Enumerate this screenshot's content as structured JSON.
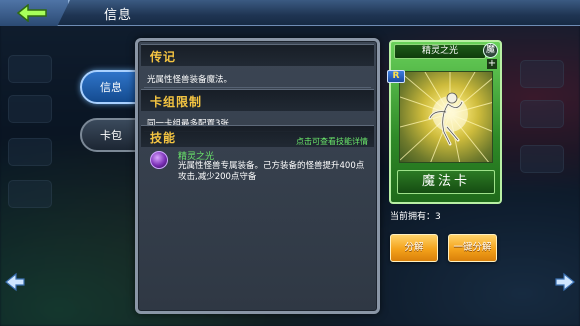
{
  "header": {
    "title": "信息"
  },
  "tabs": [
    {
      "label": "信息",
      "active": true
    },
    {
      "label": "卡包",
      "active": false
    }
  ],
  "info": {
    "lore": {
      "title": "传记",
      "text": "光属性怪兽装备魔法。"
    },
    "deck_limit": {
      "title": "卡组限制",
      "text": "同一卡组最多配置3张"
    },
    "skill": {
      "title": "技能",
      "detail_link": "点击可查看技能详情",
      "name": "精灵之光",
      "description": "光属性怪兽专属装备。己方装备的怪兽提升400点攻击,减少200点守备"
    }
  },
  "card": {
    "name": "精灵之光",
    "attribute": "魔",
    "rarity": "R",
    "plus": "+",
    "type": "魔法卡"
  },
  "owned": "当前拥有：3",
  "buttons": {
    "decompose": "分解",
    "decompose_all": "一键分解"
  },
  "colors": {
    "accent_gold": "#f5c542",
    "skill_green": "#6be86b",
    "button_orange": "#f4a21b"
  },
  "icons": {
    "back": "back-arrow-icon",
    "prev": "left-arrow-icon",
    "next": "right-arrow-icon",
    "skill": "spell-orb-icon"
  }
}
